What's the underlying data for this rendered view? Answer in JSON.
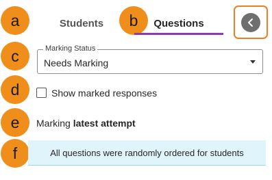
{
  "callouts": [
    "a",
    "b",
    "c",
    "d",
    "e",
    "f"
  ],
  "tabs": {
    "students_label": "Students",
    "questions_label": "Questions",
    "active": "Questions"
  },
  "marking_status": {
    "legend": "Marking Status",
    "value": "Needs Marking"
  },
  "show_marked": {
    "label": "Show marked responses",
    "checked": false
  },
  "marking": {
    "prefix": "Marking",
    "emphasis": "latest attempt"
  },
  "notice": {
    "text": "All questions were randomly ordered for students"
  },
  "colors": {
    "callout": "#ef8e1b",
    "active_tab_underline": "#8a3cb5",
    "highlight_frame": "#ef7d22",
    "notice_bg": "#dff4fb"
  },
  "icons": {
    "collapse": "chevron-left-icon",
    "dropdown": "caret-down-icon"
  }
}
